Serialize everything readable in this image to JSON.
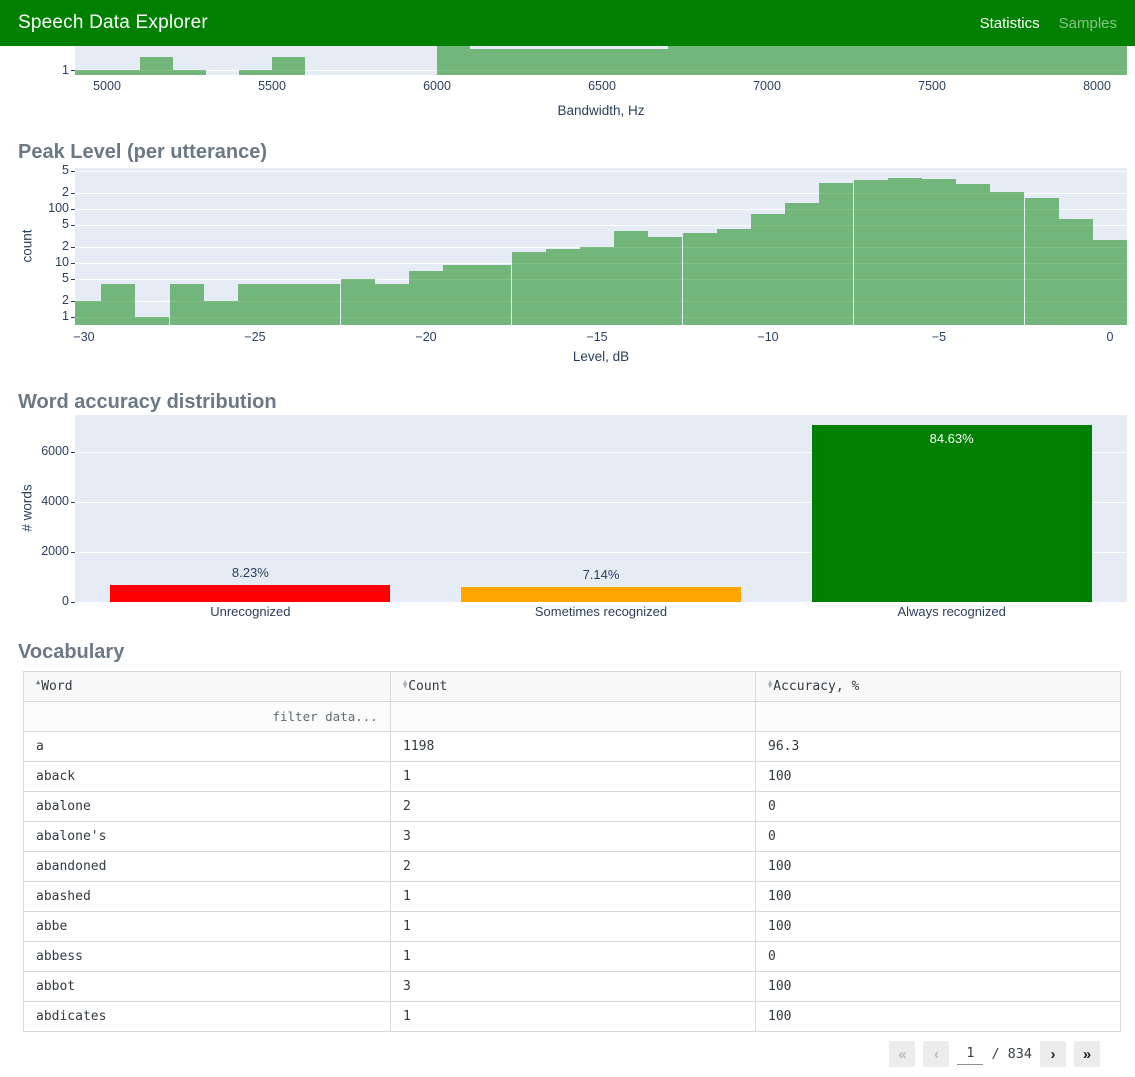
{
  "colors": {
    "header_green": "#008000",
    "plot_background": "#e5ecf6",
    "histogram_bar": "rgba(0,128,0,0.5)",
    "axis_text": "#2a3f5f",
    "bar_red": "#ff0000",
    "bar_orange": "#ffa500",
    "bar_green": "#008000"
  },
  "header": {
    "title": "Speech Data Explorer",
    "nav": [
      {
        "label": "Statistics",
        "active": true
      },
      {
        "label": "Samples",
        "active": false
      }
    ]
  },
  "chart_data": [
    {
      "id": "bandwidth",
      "type": "histogram",
      "title": "",
      "xlabel": "Bandwidth, Hz",
      "yscale": "log",
      "note": "only the bottom slice of this histogram is visible; tall bars are clipped by the top of the viewport",
      "x_ticks": [
        5000,
        5500,
        6000,
        6500,
        7000,
        7500,
        8000
      ],
      "visible_y_ticks": [
        1
      ],
      "bins": [
        [
          4890,
          5000,
          1
        ],
        [
          5000,
          5100,
          1
        ],
        [
          5100,
          5200,
          2
        ],
        [
          5200,
          5300,
          1
        ],
        [
          5400,
          5500,
          1
        ],
        [
          5500,
          5600,
          2
        ],
        [
          6000,
          6100,
          4
        ],
        [
          6100,
          6700,
          3
        ],
        [
          6700,
          8095,
          4
        ]
      ]
    },
    {
      "id": "peak_level",
      "type": "histogram",
      "title": "Peak Level (per utterance)",
      "xlabel": "Level, dB",
      "ylabel": "count",
      "yscale": "log",
      "xlim": [
        -30.3,
        0.5
      ],
      "x_ticks": [
        {
          "label": "−30",
          "value": -30
        },
        {
          "label": "−25",
          "value": -25
        },
        {
          "label": "−20",
          "value": -20
        },
        {
          "label": "−15",
          "value": -15
        },
        {
          "label": "−10",
          "value": -10
        },
        {
          "label": "−5",
          "value": -5
        },
        {
          "label": "0",
          "value": 0
        }
      ],
      "y_ticks": [
        {
          "label": "5",
          "value": 500
        },
        {
          "label": "2",
          "value": 200
        },
        {
          "label": "100",
          "value": 100
        },
        {
          "label": "5",
          "value": 50
        },
        {
          "label": "2",
          "value": 20
        },
        {
          "label": "10",
          "value": 10
        },
        {
          "label": "5",
          "value": 5
        },
        {
          "label": "2",
          "value": 2
        },
        {
          "label": "1",
          "value": 1
        }
      ],
      "bin_start": -30.5,
      "bin_width": 1,
      "values": [
        2,
        4,
        1,
        4,
        2,
        4,
        4,
        4,
        5,
        4,
        7,
        9,
        9,
        16,
        18,
        20,
        39,
        30,
        36,
        43,
        81,
        130,
        300,
        345,
        380,
        360,
        290,
        208,
        160,
        65,
        27
      ]
    },
    {
      "id": "word_accuracy",
      "type": "bar",
      "title": "Word accuracy distribution",
      "ylabel": "# words",
      "categories": [
        "Unrecognized",
        "Sometimes recognized",
        "Always recognized"
      ],
      "values": [
        686,
        595,
        7053
      ],
      "pct_labels": [
        "8.23%",
        "7.14%",
        "84.63%"
      ],
      "colors": [
        "#ff0000",
        "#ffa500",
        "#008000"
      ],
      "label_inside": [
        false,
        false,
        true
      ],
      "y_ticks": [
        0,
        2000,
        4000,
        6000
      ],
      "ylim": [
        0,
        7460
      ]
    }
  ],
  "vocabulary": {
    "title": "Vocabulary",
    "columns": [
      {
        "label": "Word",
        "sort": "asc"
      },
      {
        "label": "Count",
        "sort": "both"
      },
      {
        "label": "Accuracy, %",
        "sort": "both"
      }
    ],
    "filter_placeholder": "filter data...",
    "rows": [
      [
        "a",
        "1198",
        "96.3"
      ],
      [
        "aback",
        "1",
        "100"
      ],
      [
        "abalone",
        "2",
        "0"
      ],
      [
        "abalone's",
        "3",
        "0"
      ],
      [
        "abandoned",
        "2",
        "100"
      ],
      [
        "abashed",
        "1",
        "100"
      ],
      [
        "abbe",
        "1",
        "100"
      ],
      [
        "abbess",
        "1",
        "0"
      ],
      [
        "abbot",
        "3",
        "100"
      ],
      [
        "abdicates",
        "1",
        "100"
      ]
    ]
  },
  "pagination": {
    "first": "«",
    "prev": "‹",
    "page": "1",
    "separator": "/",
    "total": "834",
    "next": "›",
    "last": "»"
  }
}
